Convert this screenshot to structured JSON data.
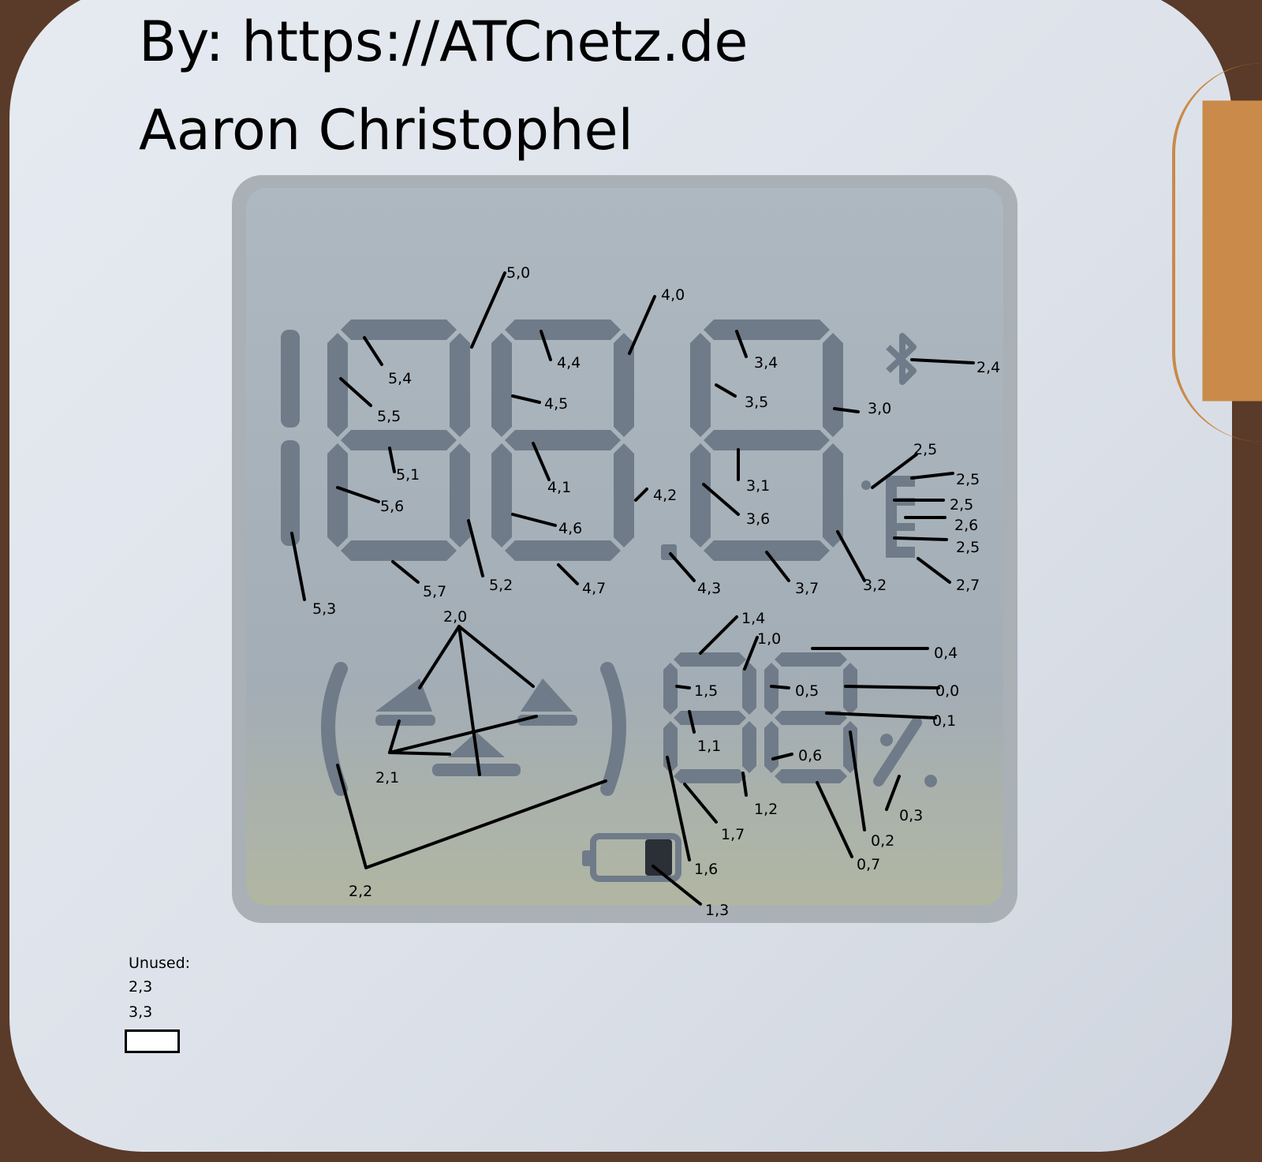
{
  "header": {
    "line1": "By: https://ATCnetz.de",
    "line2": "Aaron Christophel"
  },
  "segment_labels": [
    "5,0",
    "5,4",
    "5,5",
    "5,1",
    "5,6",
    "5,3",
    "5,7",
    "5,2",
    "4,0",
    "4,4",
    "4,5",
    "4,1",
    "4,2",
    "4,6",
    "4,7",
    "4,3",
    "3,4",
    "3,5",
    "3,0",
    "3,1",
    "3,6",
    "3,7",
    "3,2",
    "2,4",
    "2,5",
    "2,5",
    "2,5",
    "2,6",
    "2,5",
    "2,7",
    "2,0",
    "2,1",
    "2,2",
    "1,4",
    "1,0",
    "1,5",
    "1,1",
    "1,2",
    "1,7",
    "1,6",
    "1,3",
    "0,4",
    "0,5",
    "0,0",
    "0,1",
    "0,6",
    "0,3",
    "0,2",
    "0,7"
  ],
  "unused": {
    "heading": "Unused:",
    "items": [
      "2,3",
      "3,3"
    ]
  },
  "colors": {
    "lcd_background": "#a7b1ba",
    "segment": "#6f7b88",
    "leader_line": "#000000",
    "device_body": "#e1e6ed"
  },
  "icons": [
    "bluetooth-icon",
    "battery-icon",
    "smiley-face-icon",
    "percent-icon",
    "degree-celsius-icon"
  ]
}
